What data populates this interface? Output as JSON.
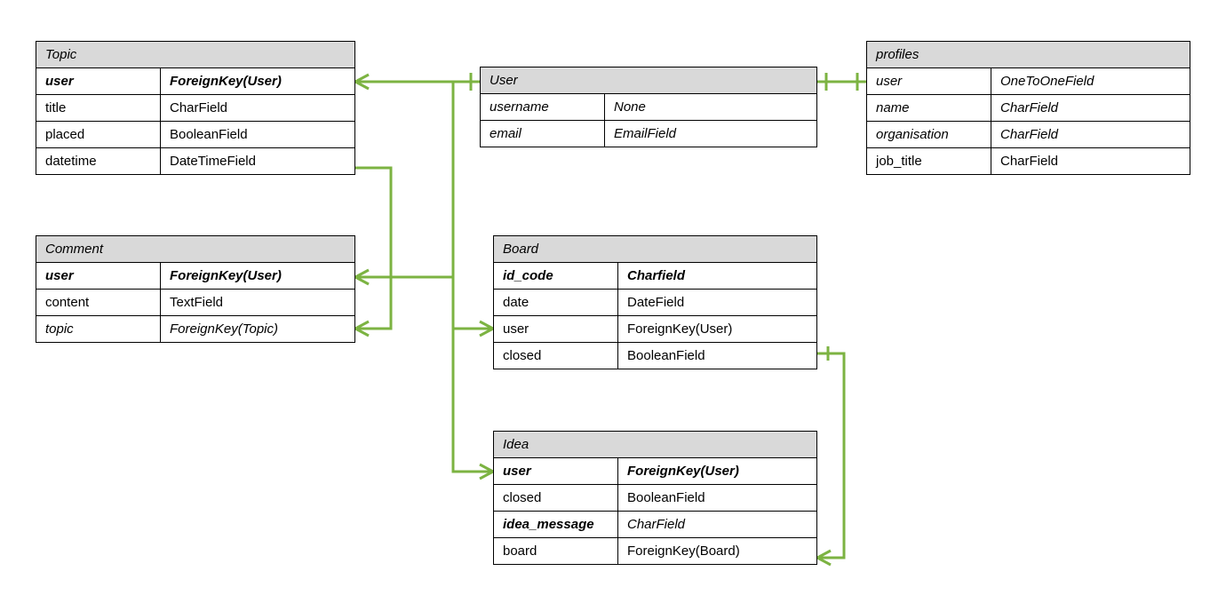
{
  "entities": {
    "topic": {
      "title": "Topic",
      "rows": [
        {
          "field": "user",
          "type": "ForeignKey(User)",
          "bold": true,
          "italic": true
        },
        {
          "field": "title",
          "type": "CharField",
          "bold": false,
          "italic": false
        },
        {
          "field": "placed",
          "type": "BooleanField",
          "bold": false,
          "italic": false
        },
        {
          "field": "datetime",
          "type": "DateTimeField",
          "bold": false,
          "italic": false
        }
      ]
    },
    "comment": {
      "title": "Comment",
      "rows": [
        {
          "field": "user",
          "type": "ForeignKey(User)",
          "bold": true,
          "italic": true
        },
        {
          "field": "content",
          "type": "TextField",
          "bold": false,
          "italic": false
        },
        {
          "field": "topic",
          "type": "ForeignKey(Topic)",
          "bold": false,
          "italic": true
        }
      ]
    },
    "user": {
      "title": "User",
      "rows": [
        {
          "field": "username",
          "type": "None",
          "bold": false,
          "italic": true
        },
        {
          "field": "email",
          "type": "EmailField",
          "bold": false,
          "italic": true
        }
      ]
    },
    "board": {
      "title": "Board",
      "rows": [
        {
          "field": "id_code",
          "type": "Charfield",
          "bold": true,
          "italic": true
        },
        {
          "field": "date",
          "type": "DateField",
          "bold": false,
          "italic": false
        },
        {
          "field": "user",
          "type": "ForeignKey(User)",
          "bold": false,
          "italic": false
        },
        {
          "field": "closed",
          "type": "BooleanField",
          "bold": false,
          "italic": false
        }
      ]
    },
    "idea": {
      "title": "Idea",
      "rows": [
        {
          "field": "user",
          "type": "ForeignKey(User)",
          "bold": true,
          "italic": true
        },
        {
          "field": "closed",
          "type": "BooleanField",
          "bold": false,
          "italic": false
        },
        {
          "field": "idea_message",
          "type": "CharField",
          "bold": true,
          "fieldItalic": true,
          "typeItalic": true
        },
        {
          "field": "board",
          "type": "ForeignKey(Board)",
          "bold": false,
          "italic": false
        }
      ]
    },
    "profiles": {
      "title": "profiles",
      "rows": [
        {
          "field": "user",
          "type": "OneToOneField",
          "bold": false,
          "italic": true
        },
        {
          "field": "name",
          "type": "CharField",
          "bold": false,
          "italic": true
        },
        {
          "field": "organisation",
          "type": "CharField",
          "bold": false,
          "italic": true
        },
        {
          "field": "job_title",
          "type": "CharField",
          "bold": false,
          "italic": false
        }
      ]
    }
  },
  "colors": {
    "edge": "#7cb342",
    "headerFill": "#d9d9d9"
  }
}
